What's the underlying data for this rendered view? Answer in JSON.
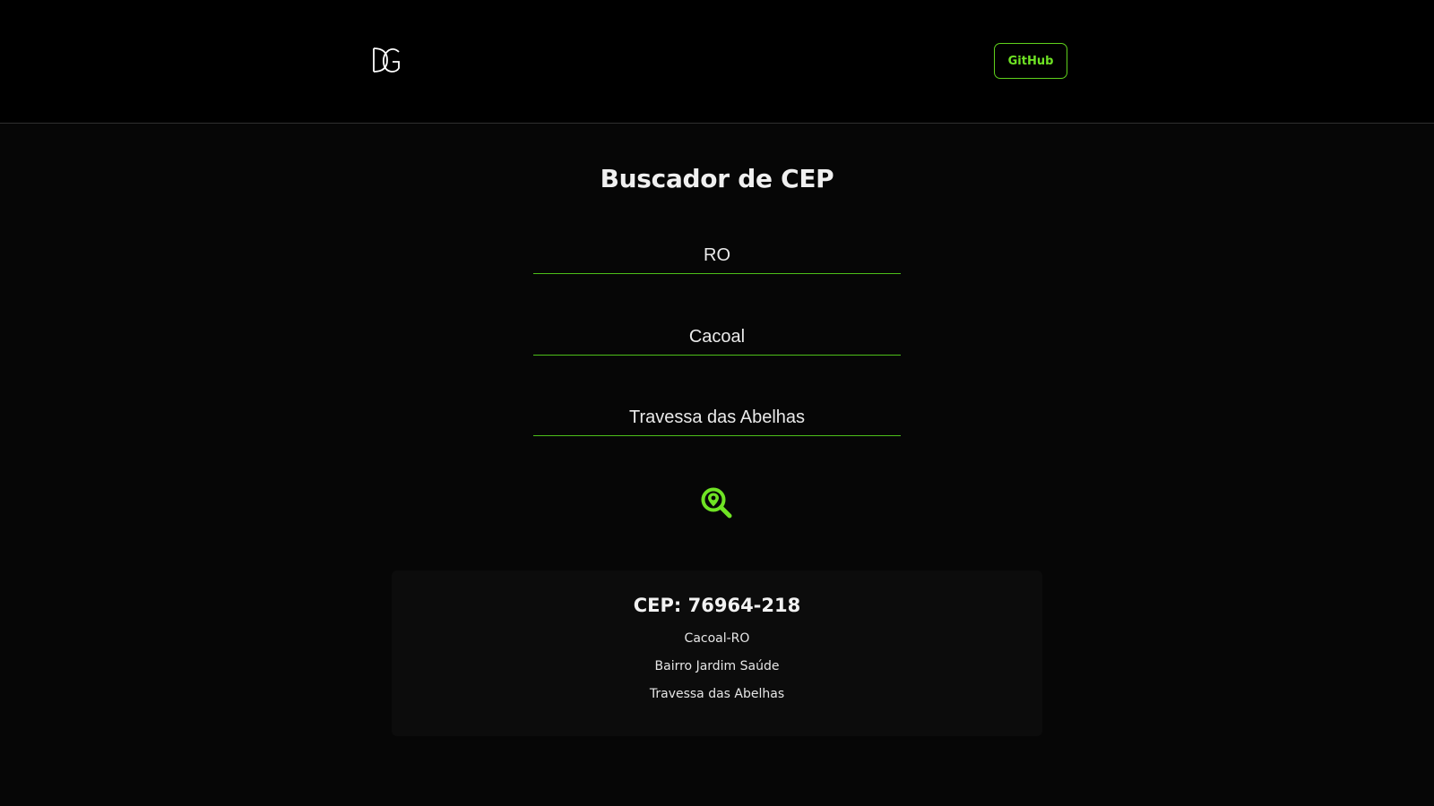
{
  "header": {
    "logo_text": "DG",
    "github_label": "GitHub"
  },
  "main": {
    "title": "Buscador de CEP",
    "fields": {
      "uf_value": "RO",
      "city_value": "Cacoal",
      "street_value": "Travessa das Abelhas"
    },
    "search_icon": "map-pin-search-icon"
  },
  "result": {
    "cep": "CEP: 76964-218",
    "city_state": "Cacoal-RO",
    "bairro": "Bairro Jardim Saúde",
    "street": "Travessa das Abelhas"
  },
  "colors": {
    "accent": "#6fe324",
    "background": "#060606",
    "header_bg": "#000000",
    "card_bg": "#0c0c0c"
  }
}
